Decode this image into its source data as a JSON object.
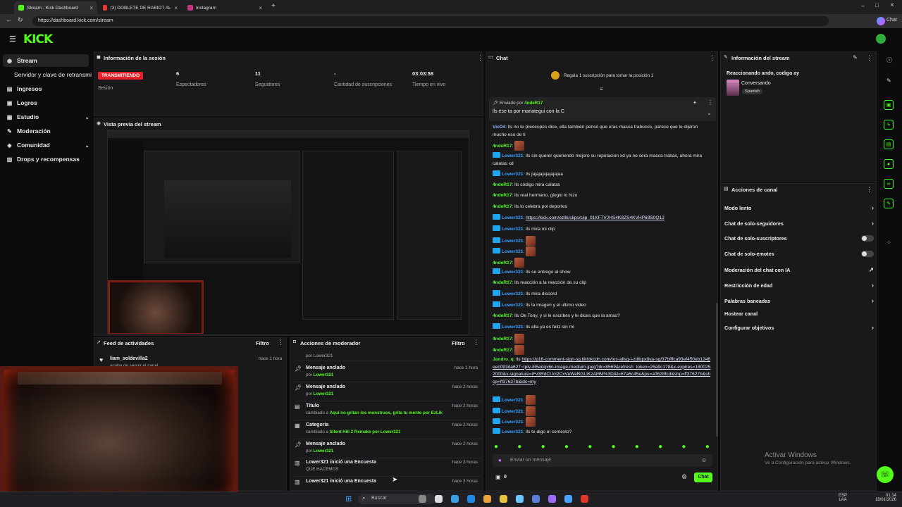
{
  "browser": {
    "tabs": [
      "Stream - Kick Dashboard",
      "(3) DOBLETE DE RABIOT AL COMO",
      "Instagram"
    ],
    "url": "https://dashboard.kick.com/stream",
    "chat_label": "Chat"
  },
  "app": {
    "logo": "KICK"
  },
  "sidebar": {
    "items": [
      {
        "label": "Stream"
      },
      {
        "label": "Servidor y clave de retransmi"
      },
      {
        "label": "Ingresos"
      },
      {
        "label": "Logros"
      },
      {
        "label": "Estudio"
      },
      {
        "label": "Moderación"
      },
      {
        "label": "Comunidad"
      },
      {
        "label": "Drops y recompensas"
      }
    ]
  },
  "session": {
    "title": "Información de la sesión",
    "status": "TRANSMITIENDO",
    "status_label": "Sesión",
    "stats": [
      {
        "value": "6",
        "label": "Espectadores"
      },
      {
        "value": "11",
        "label": "Seguidores"
      },
      {
        "value": "-",
        "label": "Cantidad de suscripciones"
      },
      {
        "value": "03:03:58",
        "label": "Tiempo en vivo"
      }
    ]
  },
  "preview": {
    "title": "Vista previa del stream"
  },
  "activity": {
    "title": "Feed de actividades",
    "filter": "Filtro",
    "items": [
      {
        "user": "liam_soldevilla2",
        "text": "acaba de seguir el canal",
        "time": "hace 1 hora"
      }
    ]
  },
  "modactions": {
    "title": "Acciones de moderador",
    "filter": "Filtro",
    "rows": [
      {
        "title": "Mensaje anclado",
        "pre": "por ",
        "user": "Lower321",
        "post": "",
        "time": "hace 1 hora"
      },
      {
        "title": "Mensaje anclado",
        "pre": "por ",
        "user": "Lower321",
        "post": "",
        "time": "hace 2 horas"
      },
      {
        "title": "Título",
        "pre": "cambiado a ",
        "user": "",
        "post": "Aquí no gritan los monstruos, grita tu mente por EzLik",
        "time": "hace 2 horas"
      },
      {
        "title": "Categoría",
        "pre": "cambiado a ",
        "user": "",
        "post": "Silent Hill 2 Remake por Lower321",
        "time": "hace 2 horas"
      },
      {
        "title": "Mensaje anclado",
        "pre": "por ",
        "user": "Lower321",
        "post": "",
        "time": "hace 2 horas"
      },
      {
        "title": "Lower321 inició una Encuesta",
        "pre": "",
        "user": "",
        "post": "QUE HACEMOS",
        "time": "hace 3 horas"
      },
      {
        "title": "Lower321 inició una Encuesta",
        "pre": "",
        "user": "",
        "post": "",
        "time": "hace 3 horas"
      }
    ],
    "top_user": "por Lower321"
  },
  "chat": {
    "title": "Chat",
    "sub_banner": "Regala 1 suscripción para tomar la posición 1",
    "pinned_by_label": "Enviado por",
    "pinned_user": "4ndeR17",
    "pinned_text": "lls ese ta por mariategui con la C",
    "input_placeholder": "Enviar un mensaje",
    "count": "0",
    "send": "Chat",
    "messages": [
      {
        "u": "VicD4",
        "c": "v",
        "t": "lls no te preocupes dice, ella también pensó que eras masca trabucos, parece que le dijeron mucho eso de ti"
      },
      {
        "u": "4ndeR17",
        "c": "g",
        "t": "",
        "e": 1
      },
      {
        "u": "Lower321",
        "c": "b",
        "t": "lls sin querer queriendo mejoro su reputacion xd ya no sera masca trabas, ahora mira calatas xd"
      },
      {
        "u": "Lower321",
        "c": "b",
        "t": "lls jajajajajajajajaa"
      },
      {
        "u": "4ndeR17",
        "c": "g",
        "t": "lls código mira calatas"
      },
      {
        "u": "4ndeR17",
        "c": "g",
        "t": "lls real hermano, glogio lo hizo"
      },
      {
        "u": "4ndeR17",
        "c": "g",
        "t": "lls lo celebra pol deportes"
      },
      {
        "u": "Lower321",
        "c": "b",
        "t": "https://kick.com/ezlik/clips/clip_01KF7VJHS4K8ZS4KVHP69S0Q12",
        "l": 1
      },
      {
        "u": "Lower321",
        "c": "b",
        "t": "lls mira mi clip"
      },
      {
        "u": "Lower321",
        "c": "b",
        "t": "",
        "e": 1
      },
      {
        "u": "Lower321",
        "c": "b",
        "t": "",
        "e": 1
      },
      {
        "u": "4ndeR17",
        "c": "g",
        "t": "",
        "e": 1
      },
      {
        "u": "Lower321",
        "c": "b",
        "t": "lls se entrego al show"
      },
      {
        "u": "4ndeR17",
        "c": "g",
        "t": "lls reacción a la reacción de su clip"
      },
      {
        "u": "Lower321",
        "c": "b",
        "t": "lls mira discord"
      },
      {
        "u": "Lower321",
        "c": "b",
        "t": "lls la imagen y el ultimo video"
      },
      {
        "u": "4ndeR17",
        "c": "g",
        "t": "lls Oe Tony, y si le escribes y le dices que la amas?"
      },
      {
        "u": "Lower321",
        "c": "b",
        "t": "lls ella ya es feliz sin mi"
      },
      {
        "u": "4ndeR17",
        "c": "g",
        "t": "",
        "e": 1
      },
      {
        "u": "4ndeR17",
        "c": "g",
        "t": "",
        "e": 1
      },
      {
        "u": "Jandro_q",
        "c": "g",
        "t": "lls https://p16-comment-sign-sg.tiktokcdn.com/tos-alisg-i-zt8igodiya-sg/37bfffca93ef450eb1246eec093da627~tplv-i85edqx6n-image-medium.jpeg?dr=8569&refresh_token=26a9c178&x-expires=1800252000&x-signature=iFv3RdCUci2CxVeWeBGLIKzAl8M%3D&t=67a6c45e&ps=a0628fcd&shp=ff37627b&shcp=ff37627b&idc=my",
        "l": 1
      },
      {
        "u": "Lower321",
        "c": "b",
        "t": "",
        "e": 1
      },
      {
        "u": "Lower321",
        "c": "b",
        "t": "",
        "e": 1
      },
      {
        "u": "Lower321",
        "c": "b",
        "t": "",
        "e": 1
      },
      {
        "u": "Lower321",
        "c": "b",
        "t": "lls te digo el contexto?"
      }
    ]
  },
  "streaminfo": {
    "title": "Información del stream",
    "stream_title": "Reaccionando ando, codigo ay",
    "category": "Conversando",
    "language": "Spanish"
  },
  "channel_actions": {
    "title": "Acciones de canal",
    "items": [
      {
        "label": "Modo lento",
        "ctrl": "arrow"
      },
      {
        "label": "Chat de solo-seguidores",
        "ctrl": "arrow"
      },
      {
        "label": "Chat de solo-suscriptores",
        "ctrl": "toggle"
      },
      {
        "label": "Chat de solo-emotes",
        "ctrl": "toggle"
      },
      {
        "label": "Moderación del chat con IA",
        "ctrl": "ext"
      },
      {
        "label": "Restricción de edad",
        "ctrl": "arrow"
      },
      {
        "label": "Palabras baneadas",
        "ctrl": "arrow"
      },
      {
        "label": "Hostear canal",
        "ctrl": ""
      },
      {
        "label": "Configurar objetivos",
        "ctrl": "arrow"
      }
    ]
  },
  "windows": {
    "activate_title": "Activar Windows",
    "activate_sub": "Ve a Configuración para activar Windows.",
    "search": "Buscar",
    "lang": "ESP",
    "lang2": "LAA",
    "time": "01:14",
    "date": "18/01/2026"
  },
  "colors": {
    "accent": "#53fc18",
    "live": "#e5202a"
  }
}
